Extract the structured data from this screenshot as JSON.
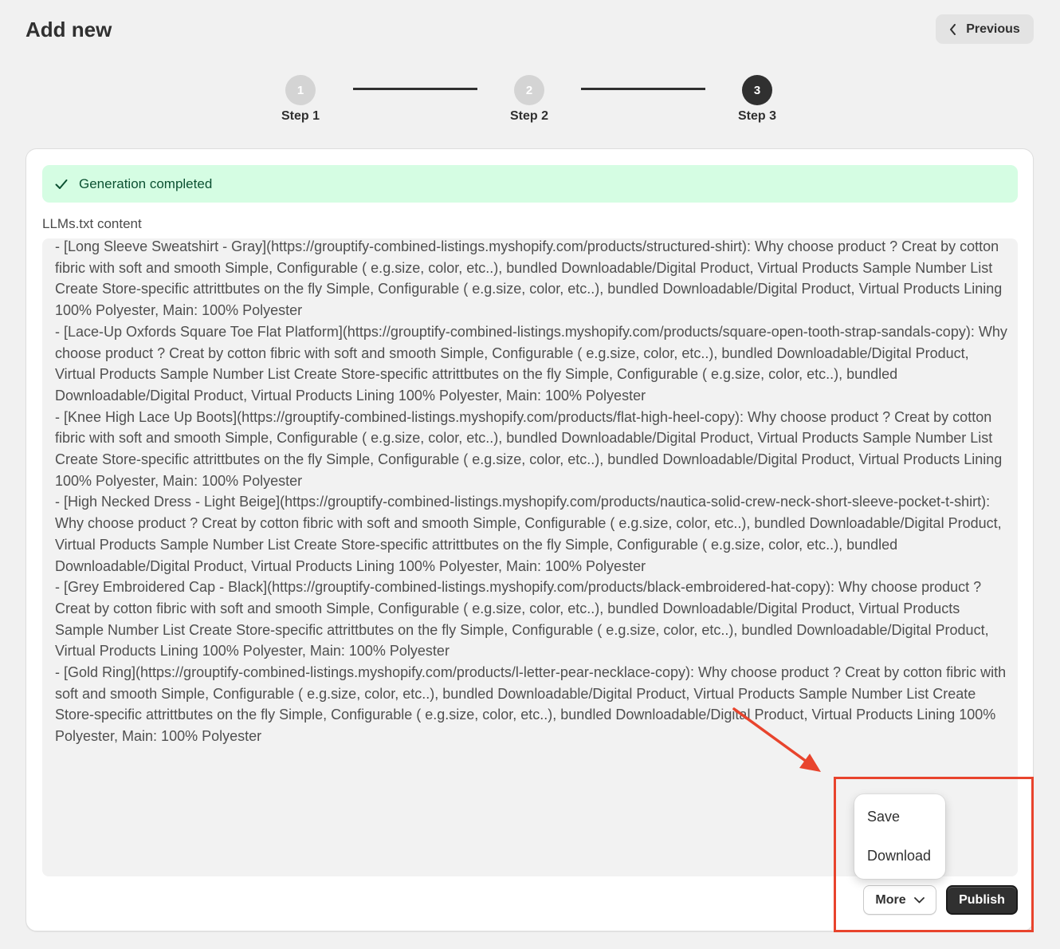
{
  "header": {
    "title": "Add new",
    "previous_label": "Previous"
  },
  "stepper": {
    "steps": [
      {
        "number": "1",
        "label": "Step 1",
        "state": "inactive"
      },
      {
        "number": "2",
        "label": "Step 2",
        "state": "inactive"
      },
      {
        "number": "3",
        "label": "Step 3",
        "state": "active"
      }
    ]
  },
  "banner": {
    "text": "Generation completed",
    "icon": "check-icon",
    "color": "#d5fde3"
  },
  "content": {
    "label": "LLMs.txt content",
    "text": "- [Long Sleeve Sweatshirt - Gray](https://grouptify-combined-listings.myshopify.com/products/structured-shirt): Why choose product ? Creat by cotton fibric with soft and smooth Simple, Configurable ( e.g.size, color, etc..), bundled Downloadable/Digital Product, Virtual Products Sample Number List Create Store-specific attrittbutes on the fly Simple, Configurable ( e.g.size, color, etc..), bundled Downloadable/Digital Product, Virtual Products Lining 100% Polyester, Main: 100% Polyester\n- [Lace-Up Oxfords Square Toe Flat Platform](https://grouptify-combined-listings.myshopify.com/products/square-open-tooth-strap-sandals-copy): Why choose product ? Creat by cotton fibric with soft and smooth Simple, Configurable ( e.g.size, color, etc..), bundled Downloadable/Digital Product, Virtual Products Sample Number List Create Store-specific attrittbutes on the fly Simple, Configurable ( e.g.size, color, etc..), bundled Downloadable/Digital Product, Virtual Products Lining 100% Polyester, Main: 100% Polyester\n- [Knee High Lace Up Boots](https://grouptify-combined-listings.myshopify.com/products/flat-high-heel-copy): Why choose product ? Creat by cotton fibric with soft and smooth Simple, Configurable ( e.g.size, color, etc..), bundled Downloadable/Digital Product, Virtual Products Sample Number List Create Store-specific attrittbutes on the fly Simple, Configurable ( e.g.size, color, etc..), bundled Downloadable/Digital Product, Virtual Products Lining 100% Polyester, Main: 100% Polyester\n- [High Necked Dress - Light Beige](https://grouptify-combined-listings.myshopify.com/products/nautica-solid-crew-neck-short-sleeve-pocket-t-shirt): Why choose product ? Creat by cotton fibric with soft and smooth Simple, Configurable ( e.g.size, color, etc..), bundled Downloadable/Digital Product, Virtual Products Sample Number List Create Store-specific attrittbutes on the fly Simple, Configurable ( e.g.size, color, etc..), bundled Downloadable/Digital Product, Virtual Products Lining 100% Polyester, Main: 100% Polyester\n- [Grey Embroidered Cap - Black](https://grouptify-combined-listings.myshopify.com/products/black-embroidered-hat-copy): Why choose product ? Creat by cotton fibric with soft and smooth Simple, Configurable ( e.g.size, color, etc..), bundled Downloadable/Digital Product, Virtual Products Sample Number List Create Store-specific attrittbutes on the fly Simple, Configurable ( e.g.size, color, etc..), bundled Downloadable/Digital Product, Virtual Products Lining 100% Polyester, Main: 100% Polyester\n- [Gold Ring](https://grouptify-combined-listings.myshopify.com/products/l-letter-pear-necklace-copy): Why choose product ? Creat by cotton fibric with soft and smooth Simple, Configurable ( e.g.size, color, etc..), bundled Downloadable/Digital Product, Virtual Products Sample Number List Create Store-specific attrittbutes on the fly Simple, Configurable ( e.g.size, color, etc..), bundled Downloadable/Digital Product, Virtual Products Lining 100% Polyester, Main: 100% Polyester"
  },
  "menu": {
    "items": [
      "Save",
      "Download"
    ]
  },
  "actions": {
    "more_label": "More",
    "publish_label": "Publish"
  },
  "annotation": {
    "color": "#e8442d"
  }
}
